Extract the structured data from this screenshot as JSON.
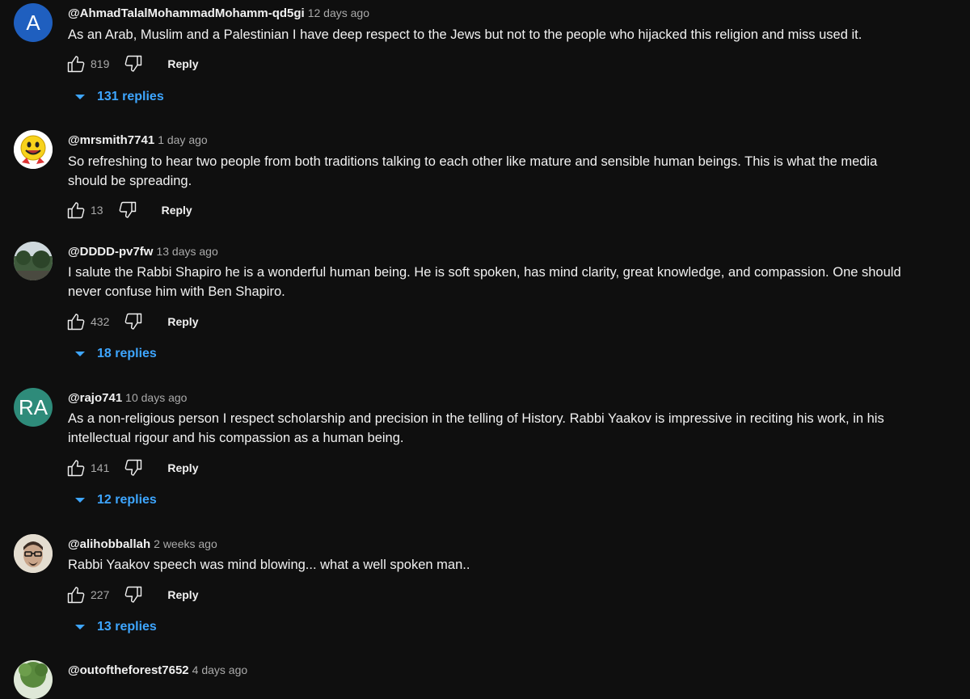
{
  "comments": [
    {
      "author": "@AhmadTalalMohammadMohamm-qd5gi",
      "time": "12 days ago",
      "avatar_letter": "A",
      "avatar_color": "#1f5fbf",
      "text": "As an Arab, Muslim and a Palestinian I have deep respect to the Jews but not to the people who hijacked this religion and miss used it.",
      "likes": "819",
      "reply_label": "Reply",
      "replies_label": "131 replies"
    },
    {
      "author": "@mrsmith7741",
      "time": "1 day ago",
      "avatar_icon": "smiley-avatar-icon",
      "text": "So refreshing to hear two people from both traditions talking to each other like mature and sensible human beings.  This is what the media should be spreading.",
      "likes": "13",
      "reply_label": "Reply"
    },
    {
      "author": "@DDDD-pv7fw",
      "time": "13 days ago",
      "avatar_icon": "landscape-photo-avatar-icon",
      "text": "I salute the Rabbi Shapiro he is a wonderful human being. He is soft spoken, has mind clarity, great knowledge, and compassion. One should never confuse him with Ben Shapiro.",
      "likes": "432",
      "reply_label": "Reply",
      "replies_label": "18 replies"
    },
    {
      "author": "@rajo741",
      "time": "10 days ago",
      "avatar_letter": "RA",
      "avatar_color": "#2e8b7a",
      "text": "As a non-religious person I respect scholarship and precision in the telling of History. Rabbi Yaakov is impressive in reciting his work, in his intellectual rigour and his compassion as a human being.",
      "likes": "141",
      "reply_label": "Reply",
      "replies_label": "12 replies"
    },
    {
      "author": "@alihobballah",
      "time": "2 weeks ago",
      "avatar_icon": "person-photo-avatar-icon",
      "text": "Rabbi Yaakov speech was mind blowing... what a well spoken man..",
      "likes": "227",
      "reply_label": "Reply",
      "replies_label": "13 replies"
    },
    {
      "author": "@outoftheforest7652",
      "time": "4 days ago",
      "avatar_icon": "tree-photo-avatar-icon"
    }
  ],
  "colors": {
    "background": "#0f0f0f",
    "primary_text": "#f1f1f1",
    "secondary_text": "#aaaaaa",
    "replies_link": "#3ea6ff"
  },
  "icons": {
    "like": "thumbs-up-icon",
    "dislike": "thumbs-down-icon",
    "expand": "caret-down-icon"
  }
}
